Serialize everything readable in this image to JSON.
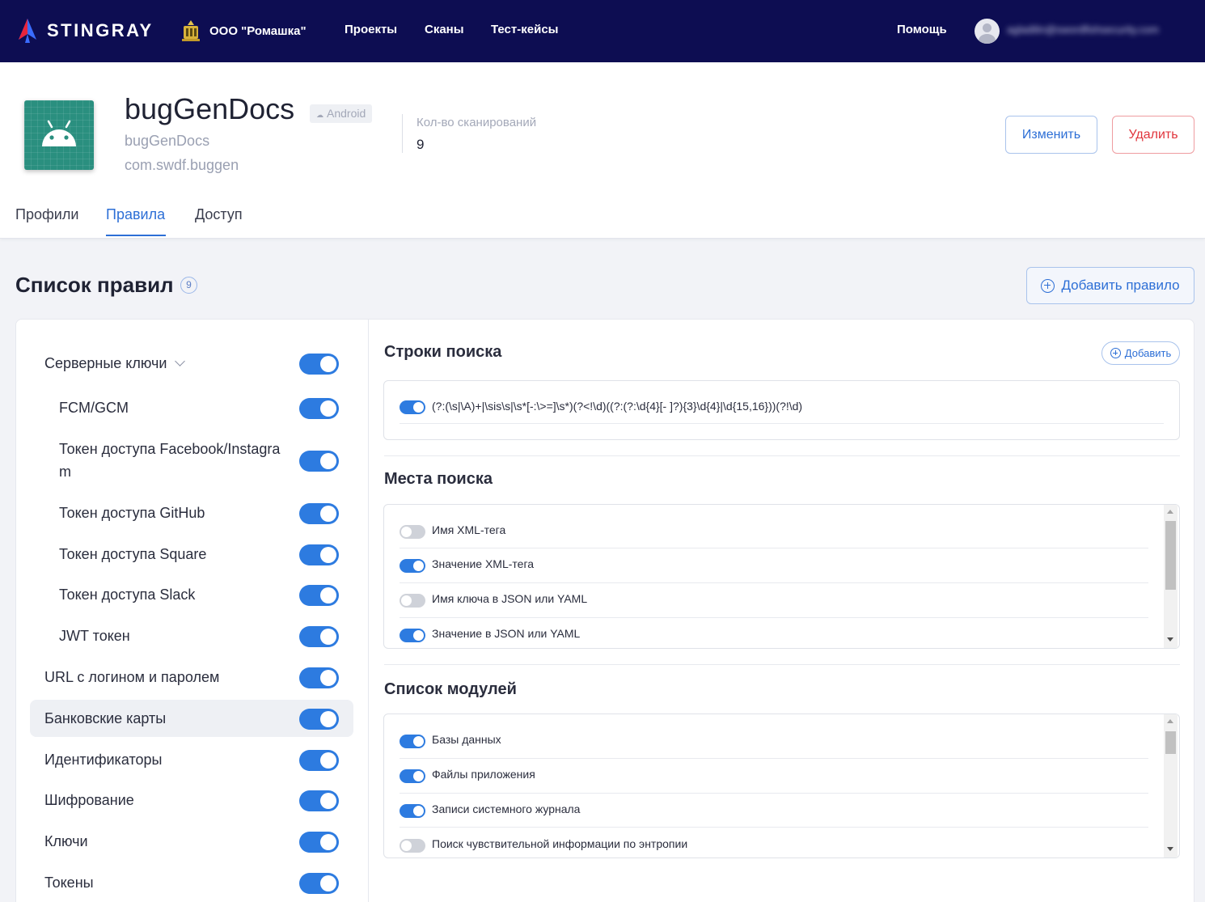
{
  "topbar": {
    "brand": "STINGRAY",
    "org": "ООО \"Ромашка\"",
    "nav": [
      "Проекты",
      "Сканы",
      "Тест-кейсы"
    ],
    "help": "Помощь",
    "user_email": "agladilin@swordfishsecurity.com",
    "colors": {
      "background": "#0d0d52",
      "logo_red": "#e8243c",
      "logo_blue": "#3a6cff"
    }
  },
  "project": {
    "name": "bugGenDocs",
    "platform": "Android",
    "subtitle": "bugGenDocs",
    "package": "com.swdf.buggen",
    "scans_label": "Кол-во сканирований",
    "scans_count": "9",
    "edit_label": "Изменить",
    "delete_label": "Удалить",
    "icon": "android-icon",
    "colors": {
      "icon_bg": "#2a8f7f",
      "accent": "#2d6fd6",
      "danger": "#e0343c"
    }
  },
  "tabs": {
    "items": [
      "Профили",
      "Правила",
      "Доступ"
    ],
    "active": "Правила"
  },
  "rules": {
    "title": "Список правил",
    "count": "9",
    "add_label": "Добавить правило",
    "items": [
      {
        "label": "Серверные ключи",
        "enabled": true,
        "expanded": true
      },
      {
        "label": "FCM/GCM",
        "enabled": true
      },
      {
        "label": "Токен доступа Facebook/Instagra",
        "label_cont": "m",
        "enabled": true
      },
      {
        "label": "Токен доступа GitHub",
        "enabled": true
      },
      {
        "label": "Токен доступа Square",
        "enabled": true
      },
      {
        "label": "Токен доступа Slack",
        "enabled": true
      },
      {
        "label": "JWT токен",
        "enabled": true
      },
      {
        "label": "URL с логином и паролем",
        "enabled": true
      },
      {
        "label": "Банковские карты",
        "enabled": true,
        "selected": true
      },
      {
        "label": "Идентификаторы",
        "enabled": true
      },
      {
        "label": "Шифрование",
        "enabled": true
      },
      {
        "label": "Ключи",
        "enabled": true
      },
      {
        "label": "Токены",
        "enabled": true
      }
    ]
  },
  "search_strings": {
    "title": "Строки поиска",
    "add_label": "Добавить",
    "items": [
      {
        "pattern": "(?:(\\s|\\A)+|\\sis\\s|\\s*[-:\\>=]\\s*)(?<!\\d)((?:(?:\\d{4}[- ]?){3}\\d{4}|\\d{15,16}))(?!\\d)",
        "enabled": true
      }
    ]
  },
  "search_places": {
    "title": "Места поиска",
    "items": [
      {
        "label": "Имя XML-тега",
        "enabled": false
      },
      {
        "label": "Значение XML-тега",
        "enabled": true
      },
      {
        "label": "Имя ключа в JSON или YAML",
        "enabled": false
      },
      {
        "label": "Значение в JSON или YAML",
        "enabled": true
      }
    ]
  },
  "modules": {
    "title": "Список модулей",
    "items": [
      {
        "label": "Базы данных",
        "enabled": true
      },
      {
        "label": "Файлы приложения",
        "enabled": true
      },
      {
        "label": "Записи системного журнала",
        "enabled": true
      },
      {
        "label": "Поиск чувствительной информации по энтропии",
        "enabled": false
      }
    ]
  }
}
